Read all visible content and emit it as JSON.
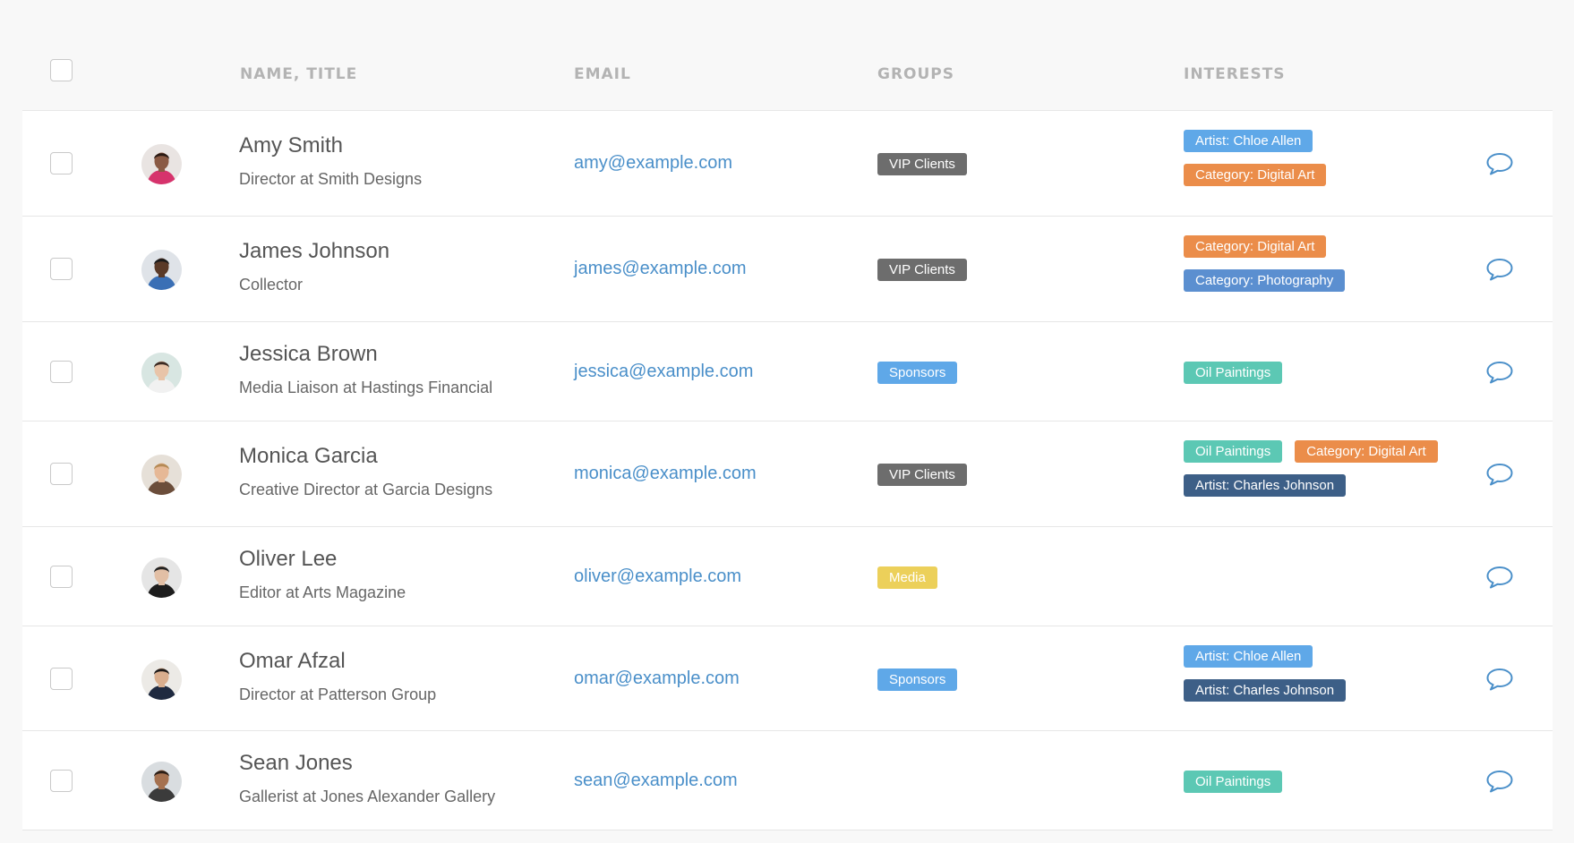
{
  "headers": {
    "name_title": "NAME, TITLE",
    "email": "EMAIL",
    "groups": "GROUPS",
    "interests": "INTERESTS"
  },
  "colors": {
    "tag_artist": "#5fa8e8",
    "tag_category_orange": "#eb8d4a",
    "tag_category_blue": "#5b8fd0",
    "tag_oil": "#5cc8b4",
    "tag_artist_dark": "#3d5f87",
    "group_vip": "#6d6d6d",
    "group_sponsors": "#5fa8e8",
    "group_media": "#ecd05a",
    "link": "#4a8fc9"
  },
  "rows": [
    {
      "name": "Amy Smith",
      "title": "Director at Smith Designs",
      "email": "amy@example.com",
      "groups": [
        {
          "label": "VIP Clients",
          "color": "#6d6d6d"
        }
      ],
      "interests": [
        {
          "label": "Artist: Chloe Allen",
          "color": "#5fa8e8"
        },
        {
          "label": "Category: Digital Art",
          "color": "#eb8d4a"
        }
      ],
      "avatar": {
        "skin": "#8a5a44",
        "hair": "#2a1a14",
        "shirt": "#d6336c",
        "bg": "#e9e4e2"
      }
    },
    {
      "name": "James Johnson",
      "title": "Collector",
      "email": "james@example.com",
      "groups": [
        {
          "label": "VIP Clients",
          "color": "#6d6d6d"
        }
      ],
      "interests": [
        {
          "label": "Category: Digital Art",
          "color": "#eb8d4a"
        },
        {
          "label": "Category: Photography",
          "color": "#5b8fd0"
        }
      ],
      "avatar": {
        "skin": "#5a3a28",
        "hair": "#1a1a1a",
        "shirt": "#3a6fb5",
        "bg": "#dfe3e8"
      }
    },
    {
      "name": "Jessica Brown",
      "title": "Media Liaison at Hastings Financial",
      "email": "jessica@example.com",
      "groups": [
        {
          "label": "Sponsors",
          "color": "#5fa8e8"
        }
      ],
      "interests": [
        {
          "label": "Oil Paintings",
          "color": "#5cc8b4"
        }
      ],
      "avatar": {
        "skin": "#e8c4a8",
        "hair": "#3b2a22",
        "shirt": "#f1f1f1",
        "bg": "#d8e6e2"
      }
    },
    {
      "name": "Monica Garcia",
      "title": "Creative Director at Garcia Designs",
      "email": "monica@example.com",
      "groups": [
        {
          "label": "VIP Clients",
          "color": "#6d6d6d"
        }
      ],
      "interests": [
        {
          "label": "Oil Paintings",
          "color": "#5cc8b4"
        },
        {
          "label": "Category: Digital Art",
          "color": "#eb8d4a"
        },
        {
          "label": "Artist: Charles Johnson",
          "color": "#3d5f87"
        }
      ],
      "avatar": {
        "skin": "#e6b896",
        "hair": "#b58a55",
        "shirt": "#6b4d3a",
        "bg": "#e6e0d8"
      }
    },
    {
      "name": "Oliver Lee",
      "title": "Editor at Arts Magazine",
      "email": "oliver@example.com",
      "groups": [
        {
          "label": "Media",
          "color": "#ecd05a"
        }
      ],
      "interests": [],
      "avatar": {
        "skin": "#e2bfa5",
        "hair": "#222222",
        "shirt": "#1d1d1d",
        "bg": "#e5e5e5"
      }
    },
    {
      "name": "Omar Afzal",
      "title": "Director at Patterson Group",
      "email": "omar@example.com",
      "groups": [
        {
          "label": "Sponsors",
          "color": "#5fa8e8"
        }
      ],
      "interests": [
        {
          "label": "Artist: Chloe Allen",
          "color": "#5fa8e8"
        },
        {
          "label": "Artist: Charles Johnson",
          "color": "#3d5f87"
        }
      ],
      "avatar": {
        "skin": "#d9ae8e",
        "hair": "#1e1a18",
        "shirt": "#1f2a40",
        "bg": "#eceae6"
      }
    },
    {
      "name": "Sean Jones",
      "title": "Gallerist at Jones Alexander Gallery",
      "email": "sean@example.com",
      "groups": [],
      "interests": [
        {
          "label": "Oil Paintings",
          "color": "#5cc8b4"
        }
      ],
      "avatar": {
        "skin": "#a5714f",
        "hair": "#2b1e16",
        "shirt": "#3b3b3b",
        "bg": "#d9dde0"
      }
    }
  ]
}
